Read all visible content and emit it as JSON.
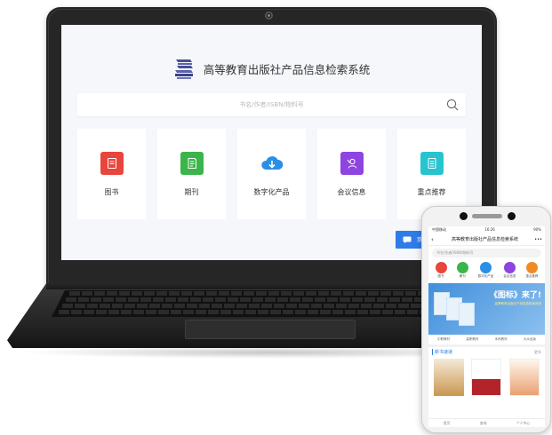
{
  "desktop": {
    "app_title": "高等教育出版社产品信息检索系统",
    "search": {
      "placeholder": "书名/作者/ISBN/物料号"
    },
    "categories": [
      {
        "label": "图书",
        "icon": "book-icon",
        "color": "#e8453c"
      },
      {
        "label": "期刊",
        "icon": "journal-icon",
        "color": "#3bb54a"
      },
      {
        "label": "数字化产品",
        "icon": "cloud-download-icon",
        "color": "#2a8fe6"
      },
      {
        "label": "会议信息",
        "icon": "conference-icon",
        "color": "#8e44e0"
      },
      {
        "label": "重点推荐",
        "icon": "recommend-icon",
        "color": "#27c4d0"
      }
    ],
    "chat_button": {
      "label": "欢",
      "icon": "chat-icon",
      "color": "#2f7ce8"
    },
    "accent": "#2f7ce8",
    "background": "#f5f7fa"
  },
  "phone": {
    "status": {
      "carrier": "中国移动",
      "time": "16:26",
      "battery": "90%"
    },
    "nav_title": "高等教育出版社产品信息检索系统",
    "search_placeholder": "书名/作者/ISBN/物料号",
    "icons": [
      {
        "label": "图书",
        "color": "#e8453c"
      },
      {
        "label": "期刊",
        "color": "#3bb54a"
      },
      {
        "label": "数字化产品",
        "color": "#2a8fe6"
      },
      {
        "label": "会议信息",
        "color": "#8e44e0"
      },
      {
        "label": "重点推荐",
        "color": "#f08a24"
      }
    ],
    "banner": {
      "title": "《图标》来了!",
      "subtitle": "高等教育出版社产品信息检索系统"
    },
    "tags": [
      "中职教材",
      "高职教材",
      "本科教材",
      "大众出版"
    ],
    "section": {
      "name": "新书速递",
      "more": "更多"
    },
    "tabbar": [
      "首页",
      "查询",
      "个人中心"
    ]
  }
}
